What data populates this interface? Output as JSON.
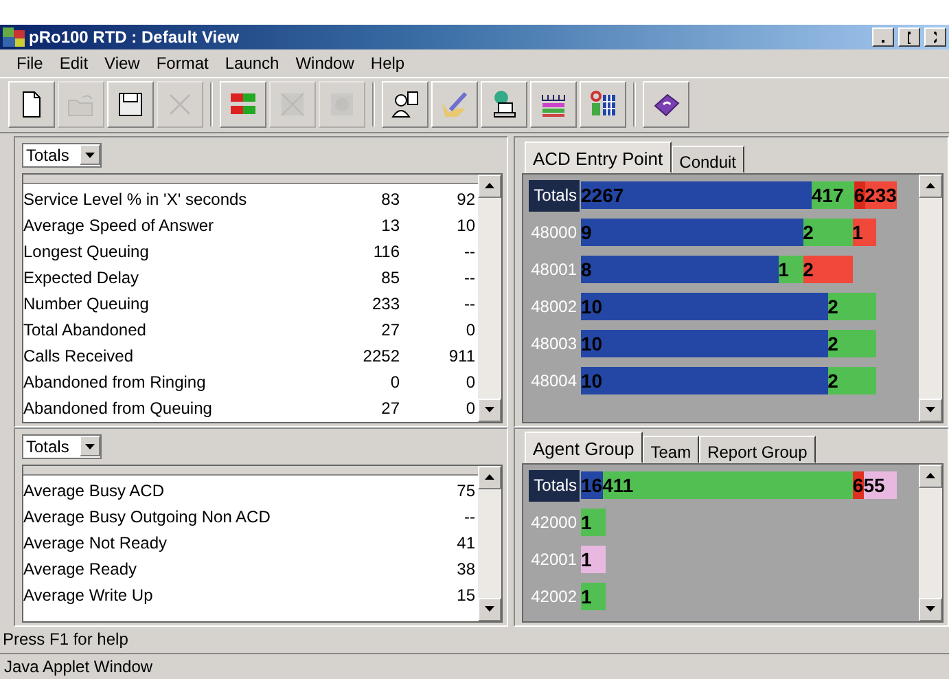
{
  "window": {
    "title": "pRo100 RTD : Default View"
  },
  "menu": [
    "File",
    "Edit",
    "View",
    "Format",
    "Launch",
    "Window",
    "Help"
  ],
  "toolbar": {
    "groups": [
      {
        "buttons": [
          {
            "disabled": false
          },
          {
            "disabled": true
          },
          {
            "disabled": false
          },
          {
            "disabled": true
          }
        ]
      },
      {
        "buttons": [
          {
            "disabled": false
          },
          {
            "disabled": true
          },
          {
            "disabled": true
          }
        ]
      },
      {
        "buttons": [
          {
            "disabled": false
          },
          {
            "disabled": false
          },
          {
            "disabled": false
          },
          {
            "disabled": false
          },
          {
            "disabled": false
          }
        ]
      },
      {
        "buttons": [
          {
            "disabled": false
          }
        ]
      }
    ]
  },
  "left_panels": [
    {
      "selector": "Totals",
      "rows": [
        {
          "label": "Service Level % in 'X' seconds",
          "values": [
            "83",
            "92"
          ]
        },
        {
          "label": "Average Speed of Answer",
          "values": [
            "13",
            "10"
          ]
        },
        {
          "label": "Longest Queuing",
          "values": [
            "116",
            "--"
          ]
        },
        {
          "label": "Expected Delay",
          "values": [
            "85",
            "--"
          ]
        },
        {
          "label": "Number Queuing",
          "values": [
            "233",
            "--"
          ]
        },
        {
          "label": "Total Abandoned",
          "values": [
            "27",
            "0"
          ]
        },
        {
          "label": "Calls Received",
          "values": [
            "2252",
            "911"
          ]
        },
        {
          "label": "Abandoned from Ringing",
          "values": [
            "0",
            "0"
          ]
        },
        {
          "label": "Abandoned from Queuing",
          "values": [
            "27",
            "0"
          ]
        }
      ]
    },
    {
      "selector": "Totals",
      "rows": [
        {
          "label": "Average Busy ACD",
          "values": [
            "75"
          ]
        },
        {
          "label": "Average Busy Outgoing Non ACD",
          "values": [
            "--"
          ]
        },
        {
          "label": "Average Not Ready",
          "values": [
            "41"
          ]
        },
        {
          "label": "Average Ready",
          "values": [
            "38"
          ]
        },
        {
          "label": "Average Write Up",
          "values": [
            "15"
          ]
        }
      ]
    }
  ],
  "right_panels": [
    {
      "tabs": [
        {
          "label": "ACD Entry Point",
          "selected": true
        },
        {
          "label": "Conduit",
          "selected": false
        }
      ],
      "rows": [
        {
          "kind": "total",
          "label": "Totals",
          "segments": [
            {
              "label": "2267",
              "color": "#2447a6"
            },
            {
              "label": "417",
              "color": "#52bf52"
            },
            {
              "label": "6",
              "color": "#d92b1c"
            },
            {
              "label": "233",
              "color": "#f0483a"
            }
          ]
        },
        {
          "kind": "item",
          "label": "48000",
          "segments": [
            {
              "label": "9",
              "color": "#2447a6"
            },
            {
              "label": "2",
              "color": "#52bf52"
            },
            {
              "label": "1",
              "color": "#f0483a"
            }
          ]
        },
        {
          "kind": "item",
          "label": "48001",
          "segments": [
            {
              "label": "8",
              "color": "#2447a6"
            },
            {
              "label": "1",
              "color": "#52bf52"
            },
            {
              "label": "2",
              "color": "#f0483a"
            }
          ]
        },
        {
          "kind": "item",
          "label": "48002",
          "segments": [
            {
              "label": "10",
              "color": "#2447a6"
            },
            {
              "label": "2",
              "color": "#52bf52"
            }
          ]
        },
        {
          "kind": "item",
          "label": "48003",
          "segments": [
            {
              "label": "10",
              "color": "#2447a6"
            },
            {
              "label": "2",
              "color": "#52bf52"
            }
          ]
        },
        {
          "kind": "item",
          "label": "48004",
          "segments": [
            {
              "label": "10",
              "color": "#2447a6"
            },
            {
              "label": "2",
              "color": "#52bf52"
            }
          ]
        }
      ]
    },
    {
      "tabs": [
        {
          "label": "Agent Group",
          "selected": true
        },
        {
          "label": "Team",
          "selected": false
        },
        {
          "label": "Report Group",
          "selected": false
        }
      ],
      "rows": [
        {
          "kind": "total",
          "label": "Totals",
          "segments": [
            {
              "label": "16",
              "color": "#2447a6"
            },
            {
              "label": "411",
              "color": "#52bf52"
            },
            {
              "label": "6",
              "color": "#e0301f"
            },
            {
              "label": "55",
              "color": "#e8b8e0"
            }
          ]
        },
        {
          "kind": "item",
          "label": "42000",
          "segments": [
            {
              "label": "1",
              "color": "#52bf52"
            }
          ]
        },
        {
          "kind": "item",
          "label": "42001",
          "segments": [
            {
              "label": "1",
              "color": "#e8b8e0"
            }
          ]
        },
        {
          "kind": "item",
          "label": "42002",
          "segments": [
            {
              "label": "1",
              "color": "#52bf52"
            }
          ]
        }
      ]
    }
  ],
  "status_bar": "Press F1 for help",
  "applet_bar": "Java Applet Window"
}
